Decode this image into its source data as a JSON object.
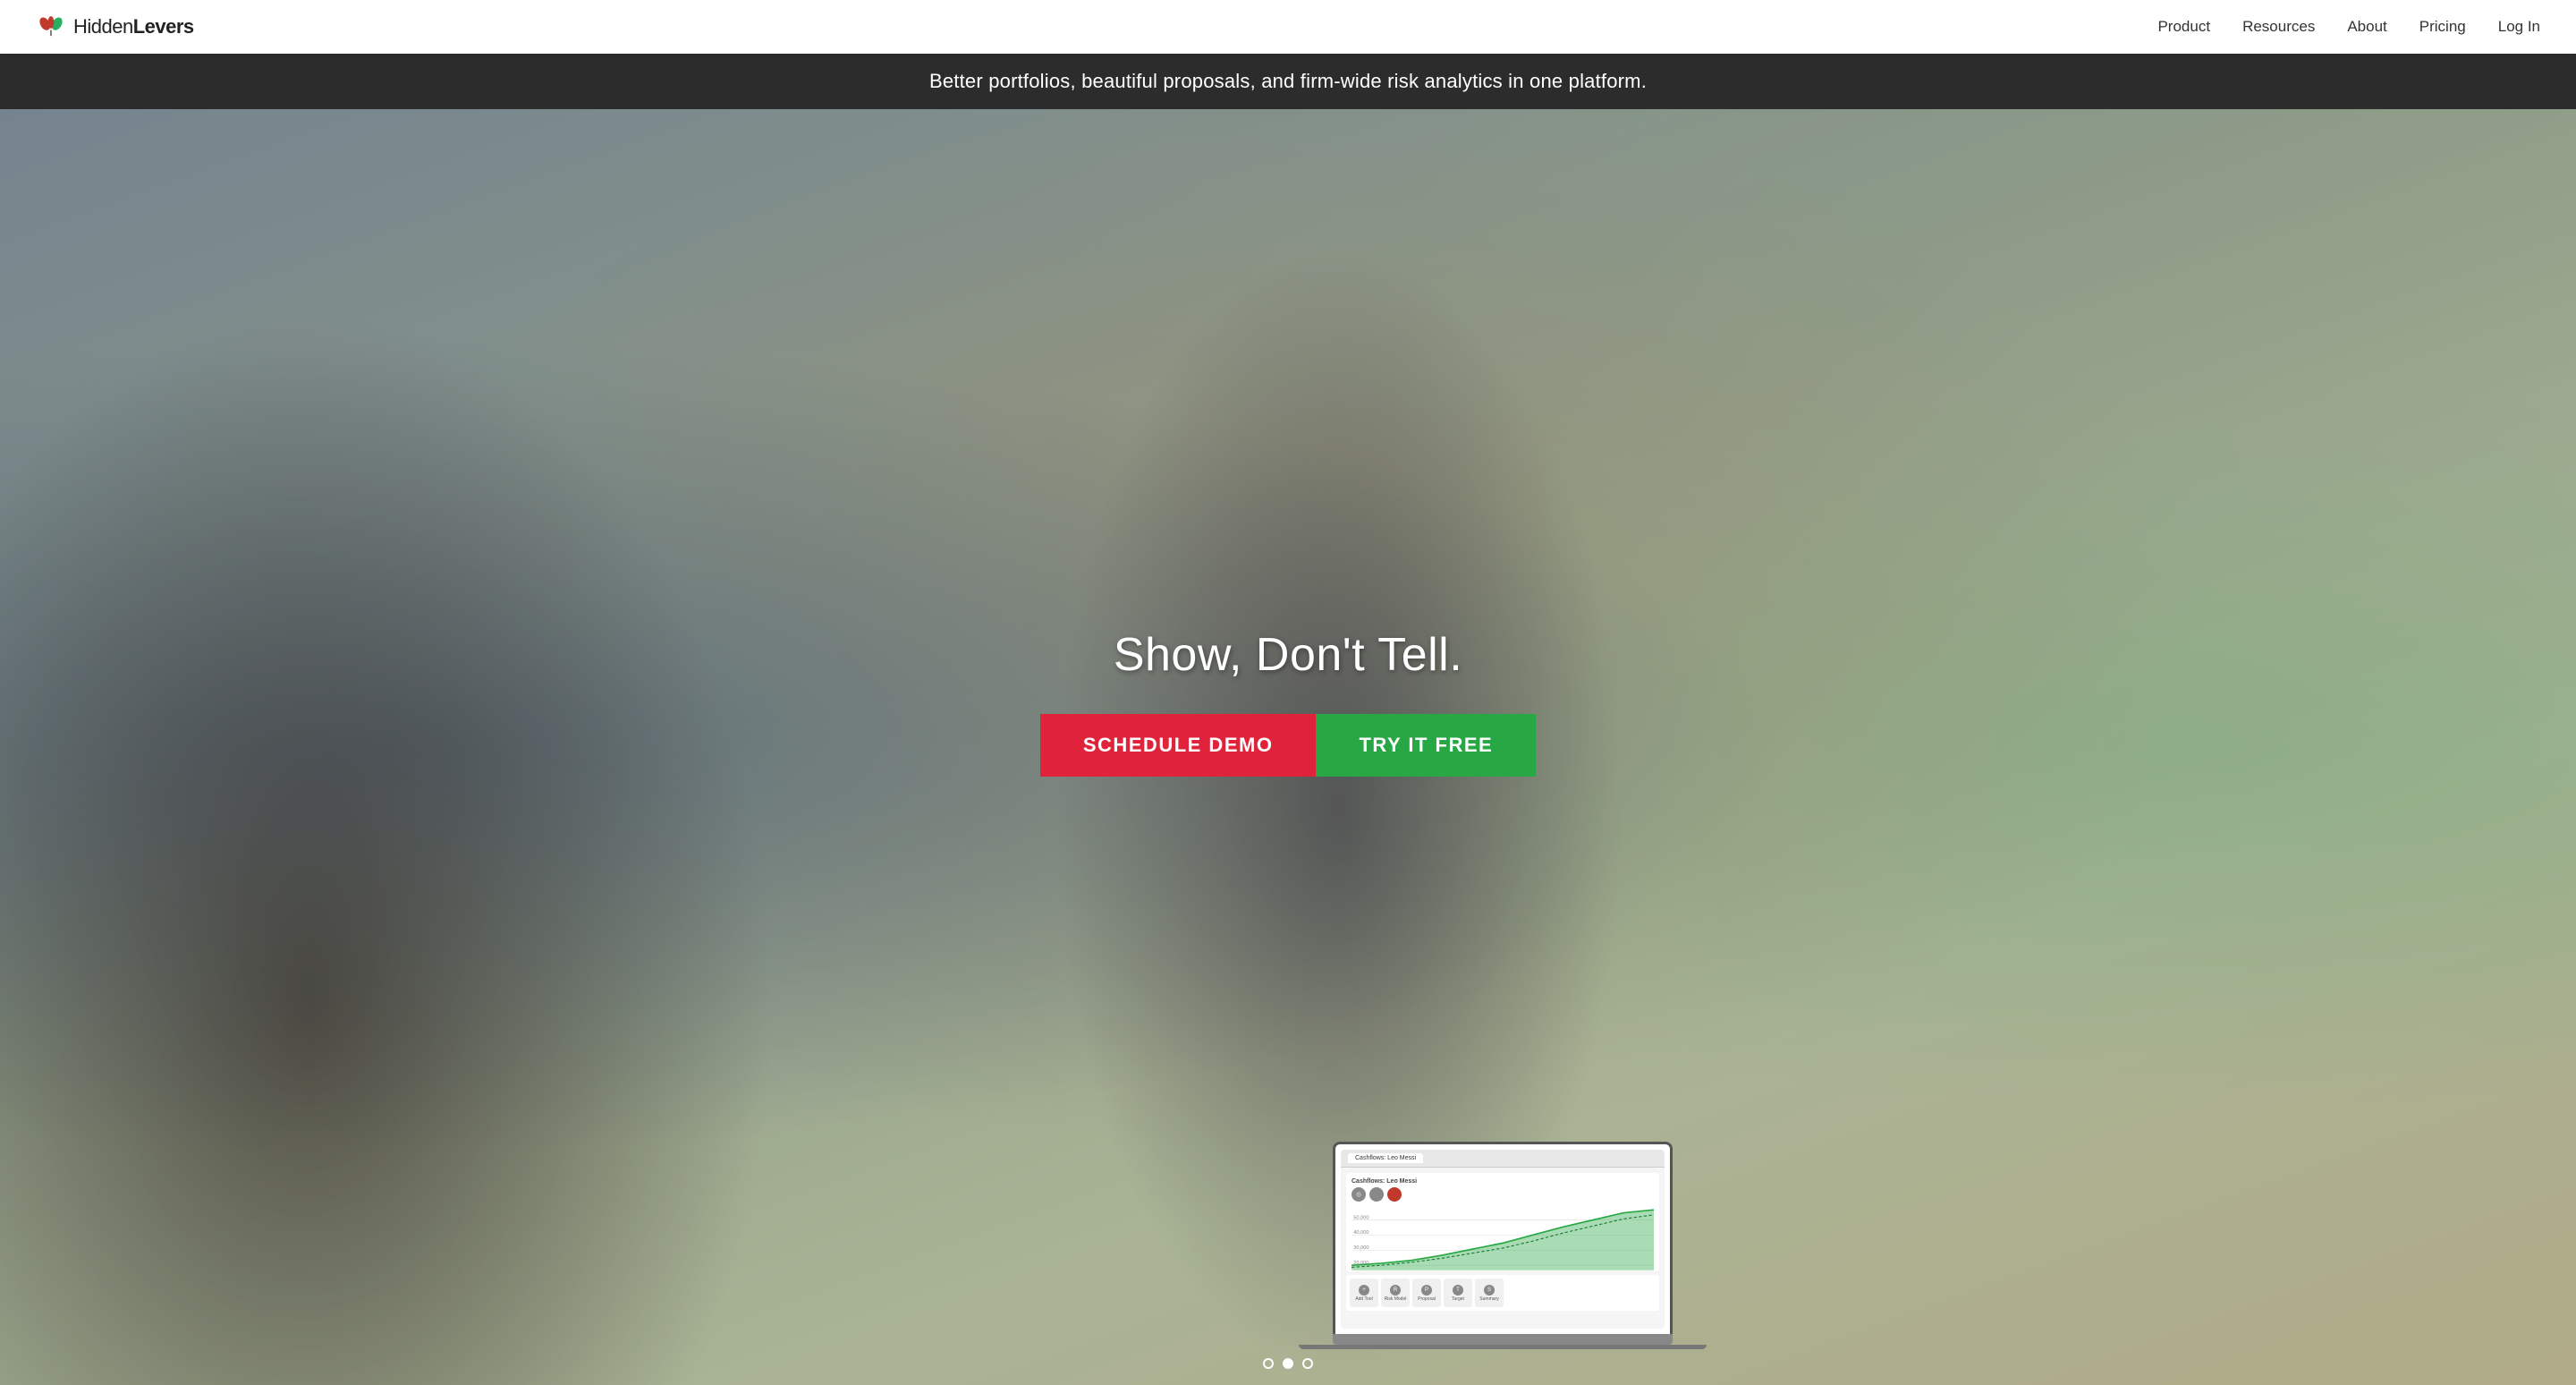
{
  "navbar": {
    "logo_text_light": "Hidden",
    "logo_text_bold": "Levers",
    "nav_items": [
      {
        "label": "Product",
        "id": "product"
      },
      {
        "label": "Resources",
        "id": "resources"
      },
      {
        "label": "About",
        "id": "about"
      },
      {
        "label": "Pricing",
        "id": "pricing"
      },
      {
        "label": "Log In",
        "id": "login"
      }
    ]
  },
  "announcement": {
    "text": "Better portfolios, beautiful proposals, and firm-wide risk analytics in one platform."
  },
  "hero": {
    "headline": "Show, Don't Tell.",
    "cta_demo_label": "SCHEDULE DEMO",
    "cta_try_label": "TRY IT FREE"
  },
  "laptop": {
    "tab_label": "Cashflows: Leo Messi"
  },
  "carousel": {
    "dots": [
      {
        "active": false,
        "index": 0
      },
      {
        "active": true,
        "index": 1
      },
      {
        "active": false,
        "index": 2
      }
    ]
  },
  "colors": {
    "accent_red": "#e0223a",
    "accent_green": "#27a844",
    "nav_bg": "#ffffff",
    "announcement_bg": "#2c2c2c",
    "announcement_text": "#ffffff"
  }
}
